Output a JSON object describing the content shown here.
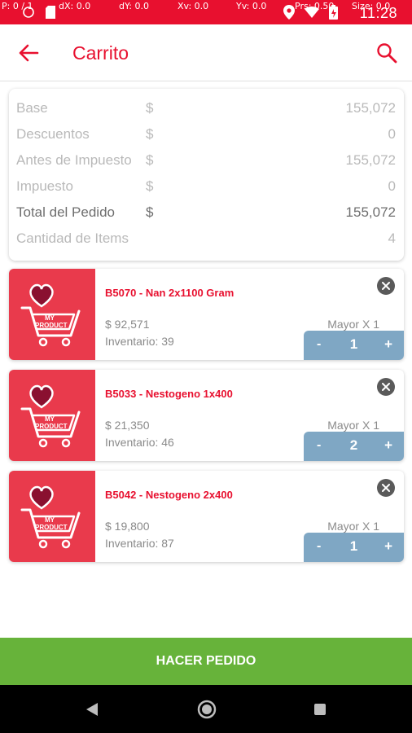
{
  "status_bar": {
    "debug": {
      "p": "P: 0 / 1",
      "dx": "dX: 0.0",
      "dy": "dY: 0.0",
      "xv": "Xv: 0.0",
      "yv": "Yv: 0.0",
      "prs": "Prs: 0.50",
      "size": "Size: 0.0"
    },
    "time": "11:28",
    "icons": [
      "location-icon",
      "wifi-icon",
      "battery-icon"
    ]
  },
  "appbar": {
    "title": "Carrito",
    "back_icon": "arrow-left-icon",
    "search_icon": "search-icon"
  },
  "summary": {
    "rows": [
      {
        "label": "Base",
        "currency": "$",
        "value": "155,072"
      },
      {
        "label": "Descuentos",
        "currency": "$",
        "value": "0"
      },
      {
        "label": "Antes de Impuesto",
        "currency": "$",
        "value": "155,072"
      },
      {
        "label": "Impuesto",
        "currency": "$",
        "value": "0"
      },
      {
        "label": "Total del Pedido",
        "currency": "$",
        "value": "155,072"
      },
      {
        "label": "Cantidad de Items",
        "currency": "",
        "value": "4"
      }
    ]
  },
  "products": [
    {
      "name": "B5070 - Nan 2x1100 Gram",
      "price": "$ 92,571",
      "stock": "Inventario: 39",
      "unit": "Mayor X 1",
      "qty": "1",
      "minus": "-",
      "plus": "+"
    },
    {
      "name": "B5033 - Nestogeno 1x400",
      "price": "$ 21,350",
      "stock": "Inventario: 46",
      "unit": "Mayor X 1",
      "qty": "2",
      "minus": "-",
      "plus": "+"
    },
    {
      "name": "B5042 - Nestogeno 2x400",
      "price": "$ 19,800",
      "stock": "Inventario: 87",
      "unit": "Mayor X 1",
      "qty": "1",
      "minus": "-",
      "plus": "+"
    }
  ],
  "thumb_text": {
    "line1": "MY",
    "line2": "PRODUCT"
  },
  "order_button": {
    "label": "HACER PEDIDO"
  },
  "colors": {
    "brand_red": "#e8102f",
    "thumb_red": "#e93a4c",
    "stepper_blue": "#7fa7c4",
    "order_green": "#67b33a"
  }
}
